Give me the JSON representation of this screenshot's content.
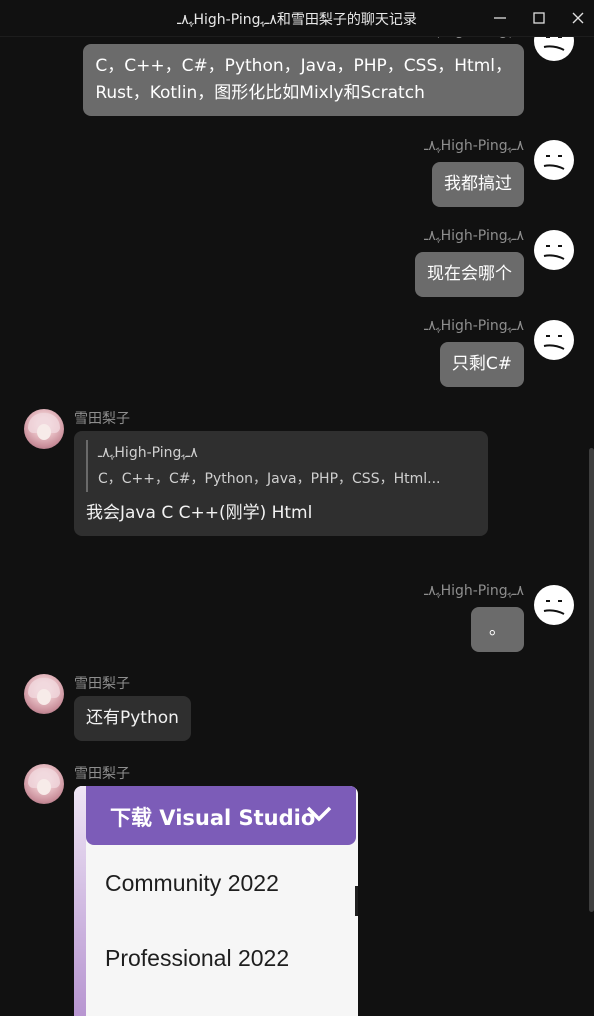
{
  "window": {
    "title": "ﮩ٨ـHigh-Ping٨ـﮩ和雪田梨子的聊天记录"
  },
  "colors": {
    "background": "#111111",
    "self_bubble": "#6b6b6b",
    "other_bubble": "#2f2f2f",
    "vs_purple": "#7c5cb8"
  },
  "users": {
    "self_name": "ﮩ٨ـHigh-Ping٨ـﮩ",
    "other_name": "雪田梨子"
  },
  "messages": [
    {
      "text": "C，C++，C#，Python，Java，PHP，CSS，Html，",
      "text2": "Rust，Kotlin，图形化比如Mixly和Scratch"
    },
    {
      "text": "我都搞过"
    },
    {
      "text": "现在会哪个"
    },
    {
      "text": "只剩C#"
    },
    {
      "quote_name": "ﮩ٨ـHigh-Ping٨ـﮩ",
      "quote_text": "C，C++，C#，Python，Java，PHP，CSS，Html...",
      "text": "我会Java C C++(刚学)   Html"
    },
    {
      "text": "。"
    },
    {
      "text": "还有Python"
    }
  ],
  "vs_image": {
    "header": "下载 Visual Studio",
    "items": [
      "Community 2022",
      "Professional 2022"
    ]
  }
}
